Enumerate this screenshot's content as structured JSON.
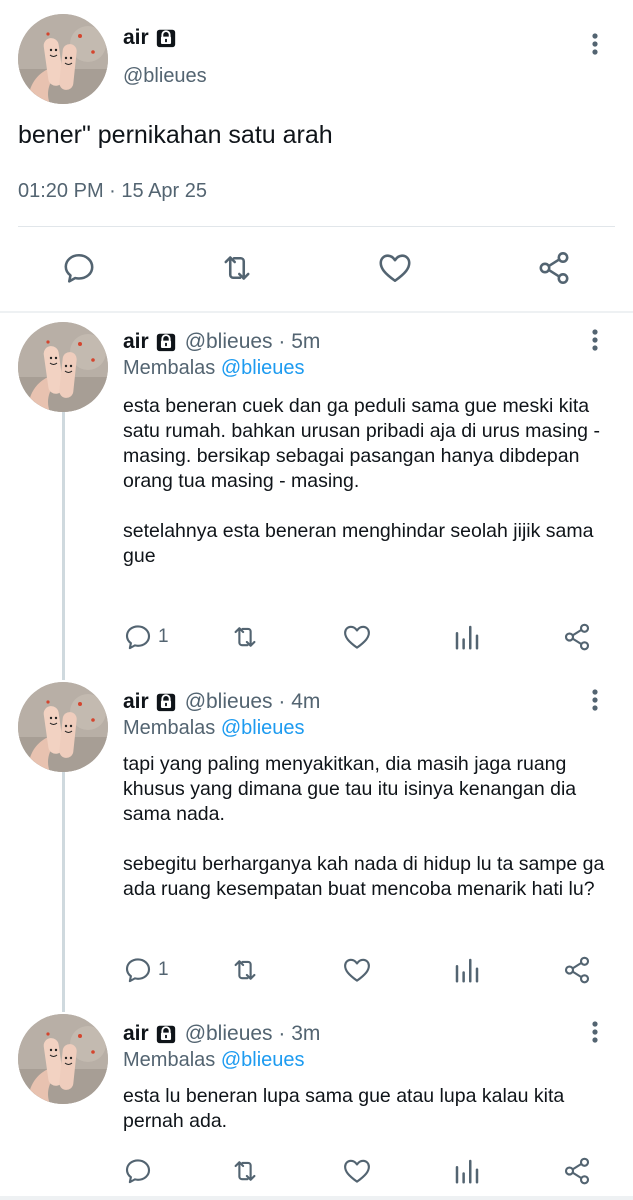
{
  "main_tweet": {
    "name": "air",
    "handle": "@blieues",
    "text": "bener\" pernikahan satu arah",
    "timestamp": "01:20 PM · 15 Apr 25",
    "actions": [
      "reply-icon",
      "retweet-icon",
      "like-icon",
      "share-icon"
    ]
  },
  "replies": [
    {
      "name": "air",
      "handle_time": "@blieues · 5m",
      "replying_prefix": "Membalas",
      "replying_mention": "@blieues",
      "paragraphs": [
        "esta beneran cuek dan ga peduli sama gue meski kita satu rumah. bahkan urusan pribadi aja di urus masing - masing. bersikap sebagai pasangan hanya dibdepan orang tua masing - masing.",
        "setelahnya esta beneran menghindar seolah jijik sama gue"
      ],
      "reply_count": "1"
    },
    {
      "name": "air",
      "handle_time": "@blieues · 4m",
      "replying_prefix": "Membalas",
      "replying_mention": "@blieues",
      "paragraphs": [
        "tapi yang paling menyakitkan, dia masih jaga ruang khusus yang dimana gue tau itu isinya kenangan dia sama nada.",
        "sebegitu berharganya kah nada di hidup lu ta sampe ga ada ruang kesempatan buat mencoba menarik hati lu?"
      ],
      "reply_count": "1"
    },
    {
      "name": "air",
      "handle_time": "@blieues · 3m",
      "replying_prefix": "Membalas",
      "replying_mention": "@blieues",
      "paragraphs": [
        "esta lu beneran lupa sama gue atau lupa kalau kita pernah ada."
      ],
      "reply_count": ""
    }
  ],
  "colors": {
    "text": "#0f1419",
    "muted": "#536471",
    "mention": "#1d9bf0",
    "divider": "#e1e6ea",
    "thread_line": "#cfd9de"
  }
}
